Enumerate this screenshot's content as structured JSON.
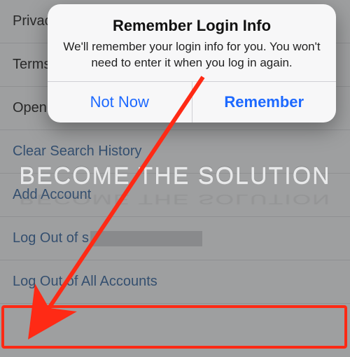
{
  "settings": {
    "rows": [
      {
        "label": "Privac",
        "link": false
      },
      {
        "label": "Terms",
        "link": false
      },
      {
        "label": "Open",
        "link": false
      },
      {
        "label": "Clear Search History",
        "link": true,
        "obscured": true,
        "visible": "Cle"
      },
      {
        "label": "Add Account",
        "link": true
      },
      {
        "label": "Log Out of s",
        "link": true,
        "redacted_tail": true
      },
      {
        "label": "Log Out of All Accounts",
        "link": true,
        "highlighted": true
      }
    ]
  },
  "alert": {
    "title": "Remember Login Info",
    "message": "We'll remember your login info for you. You won't need to enter it when you log in again.",
    "buttons": {
      "left": "Not Now",
      "right": "Remember"
    }
  },
  "watermark": {
    "text": "BECOME THE SOLUTION"
  },
  "annotation": {
    "arrow_color": "#ff2a15",
    "highlight_color": "#ff2a15"
  }
}
